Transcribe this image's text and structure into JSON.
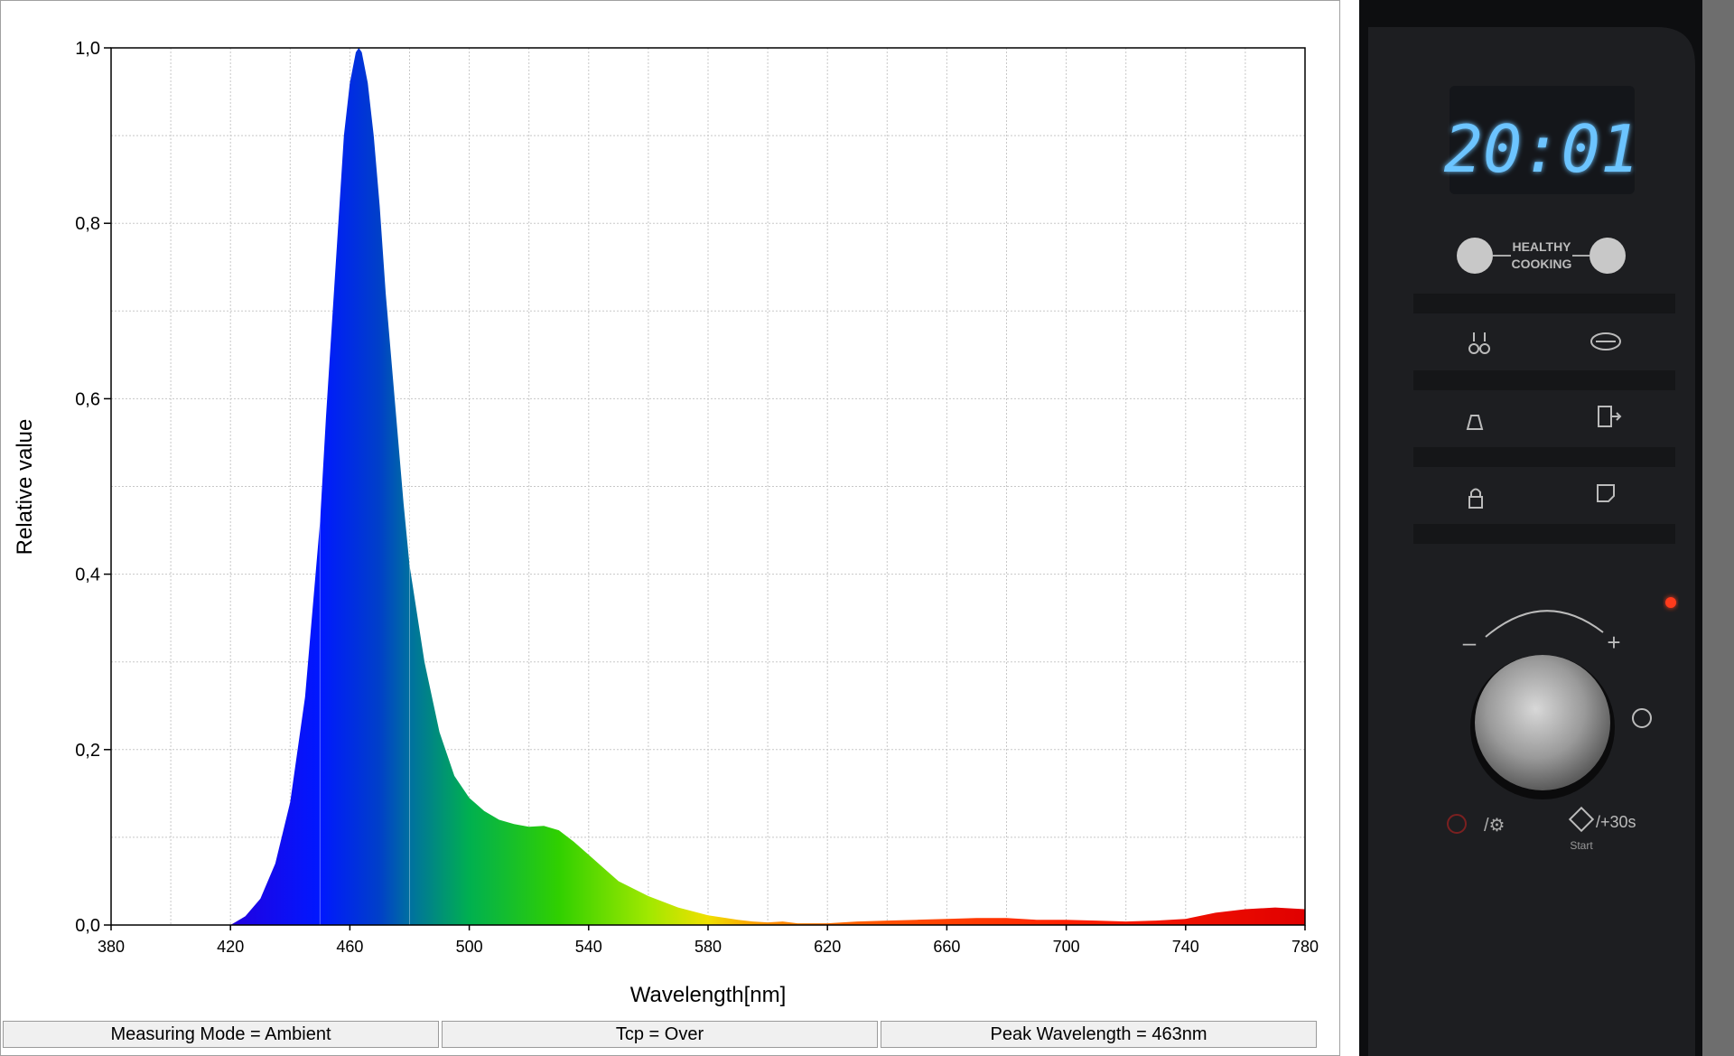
{
  "chart_data": {
    "type": "area",
    "xlabel": "Wavelength[nm]",
    "ylabel": "Relative value",
    "xlim": [
      380,
      780
    ],
    "ylim": [
      0,
      1.0
    ],
    "x_ticks": [
      380,
      420,
      460,
      500,
      540,
      580,
      620,
      660,
      700,
      740,
      780
    ],
    "y_ticks": [
      0.0,
      0.2,
      0.4,
      0.6,
      0.8,
      1.0
    ],
    "y_tick_labels": [
      "0,0",
      "0,2",
      "0,4",
      "0,6",
      "0,8",
      "1,0"
    ],
    "grid": true,
    "fill": "visible-spectrum gradient",
    "x": [
      380,
      420,
      425,
      430,
      435,
      440,
      445,
      450,
      452,
      455,
      458,
      460,
      462,
      463,
      464,
      466,
      468,
      470,
      472,
      475,
      478,
      480,
      485,
      490,
      495,
      500,
      505,
      510,
      515,
      520,
      525,
      530,
      535,
      540,
      545,
      550,
      560,
      570,
      580,
      590,
      595,
      600,
      605,
      610,
      615,
      620,
      630,
      640,
      650,
      660,
      670,
      680,
      690,
      700,
      710,
      720,
      730,
      740,
      750,
      760,
      770,
      780
    ],
    "y": [
      0.0,
      0.0,
      0.01,
      0.03,
      0.07,
      0.14,
      0.26,
      0.46,
      0.58,
      0.74,
      0.9,
      0.96,
      0.995,
      1.0,
      0.995,
      0.96,
      0.9,
      0.82,
      0.72,
      0.6,
      0.48,
      0.41,
      0.3,
      0.22,
      0.17,
      0.145,
      0.13,
      0.12,
      0.115,
      0.112,
      0.113,
      0.108,
      0.095,
      0.08,
      0.065,
      0.05,
      0.033,
      0.02,
      0.011,
      0.006,
      0.004,
      0.003,
      0.004,
      0.002,
      0.002,
      0.002,
      0.004,
      0.005,
      0.006,
      0.007,
      0.008,
      0.008,
      0.006,
      0.006,
      0.005,
      0.004,
      0.005,
      0.007,
      0.014,
      0.018,
      0.02,
      0.018
    ]
  },
  "status_bar": {
    "mode": "Measuring Mode = Ambient",
    "tcp": "Tcp = Over",
    "peak": "Peak Wavelength = 463nm"
  },
  "oven_panel": {
    "display_time": "20:01",
    "healthy_cooking": [
      "HEALTHY",
      "COOKING"
    ],
    "minus": "–",
    "plus": "+",
    "plus30": "/+30s",
    "start": "Start",
    "display_color": "#5fb8ff",
    "indicator_color": "#ff3a1a"
  }
}
